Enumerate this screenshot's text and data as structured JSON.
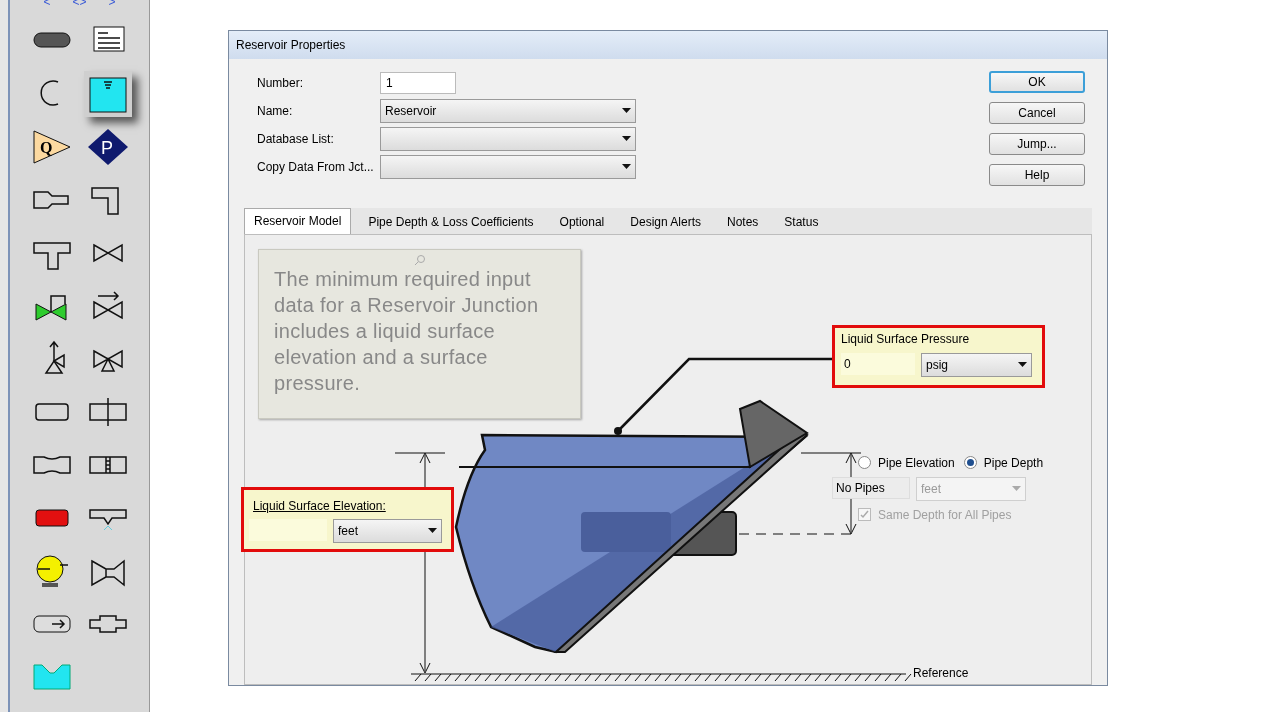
{
  "toolbar": {
    "nav": [
      "<",
      "<>",
      ">"
    ],
    "tools": [
      {
        "kind": "pipe",
        "selected": false
      },
      {
        "kind": "annotation",
        "selected": false
      },
      {
        "kind": "arc",
        "selected": false
      },
      {
        "kind": "reservoir",
        "selected": true
      },
      {
        "kind": "flow",
        "label": "Q",
        "selected": false
      },
      {
        "kind": "pressure",
        "label": "P",
        "selected": false
      },
      {
        "kind": "area-change",
        "selected": false
      },
      {
        "kind": "bend",
        "selected": false
      },
      {
        "kind": "tee",
        "selected": false
      },
      {
        "kind": "valve",
        "selected": false
      },
      {
        "kind": "control-valve",
        "selected": false
      },
      {
        "kind": "check-valve",
        "selected": false
      },
      {
        "kind": "relief-valve",
        "selected": false
      },
      {
        "kind": "three-way-valve",
        "selected": false
      },
      {
        "kind": "dead-end",
        "selected": false
      },
      {
        "kind": "orifice",
        "selected": false
      },
      {
        "kind": "venturi",
        "selected": false
      },
      {
        "kind": "screen",
        "selected": false
      },
      {
        "kind": "heat-exchanger",
        "selected": false
      },
      {
        "kind": "spray",
        "selected": false
      },
      {
        "kind": "pump",
        "selected": false
      },
      {
        "kind": "component",
        "selected": false
      },
      {
        "kind": "filter",
        "selected": false
      },
      {
        "kind": "joint",
        "selected": false
      },
      {
        "kind": "tank",
        "selected": false
      }
    ]
  },
  "window": {
    "title": "Reservoir Properties"
  },
  "fields": [
    {
      "kind": "input",
      "label": "Number:",
      "value": "1"
    },
    {
      "kind": "select",
      "label": "Name:",
      "value": "Reservoir"
    },
    {
      "kind": "select",
      "label": "Database List:"
    },
    {
      "kind": "select",
      "label": "Copy Data From Jct..."
    }
  ],
  "buttons": [
    {
      "label": "OK",
      "default": true
    },
    {
      "label": "Cancel",
      "default": false
    },
    {
      "label": "Jump...",
      "default": false
    },
    {
      "label": "Help",
      "default": false
    }
  ],
  "tabs": [
    {
      "label": "Reservoir Model",
      "selected": true
    },
    {
      "label": "Pipe Depth & Loss Coefficients",
      "selected": false
    },
    {
      "label": "Optional",
      "selected": false
    },
    {
      "label": "Design Alerts",
      "selected": false
    },
    {
      "label": "Notes",
      "selected": false
    },
    {
      "label": "Status",
      "selected": false
    }
  ],
  "tip": "The minimum required input data for a Reservoir Junction includes a liquid surface elevation and a surface pressure.",
  "pressure": {
    "label": "Liquid Surface Pressure",
    "value": "0",
    "unit": "psig"
  },
  "elevation": {
    "label": "Liquid Surface Elevation:",
    "unit": "feet"
  },
  "pipe_mode": [
    {
      "label": "Pipe Elevation",
      "selected": false
    },
    {
      "label": "Pipe Depth",
      "selected": true
    }
  ],
  "pipes": {
    "value": "No Pipes",
    "unit": "feet",
    "disabled": true
  },
  "same_depth": {
    "label": "Same Depth for All Pipes",
    "checked": true,
    "disabled": true
  },
  "reference": "Reference"
}
